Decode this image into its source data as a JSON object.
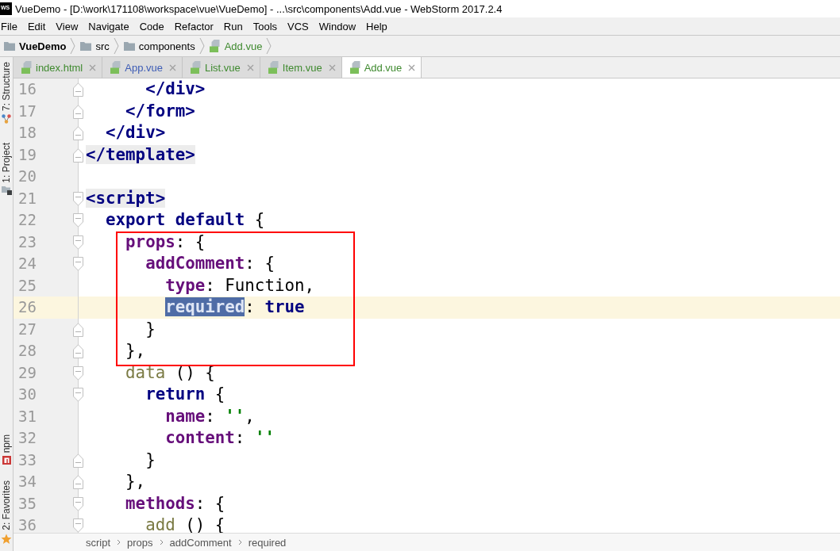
{
  "window": {
    "app_icon": "WS",
    "title": "VueDemo - [D:\\work\\171108\\workspace\\vue\\VueDemo] - ...\\src\\components\\Add.vue - WebStorm 2017.2.4"
  },
  "menu": [
    "File",
    "Edit",
    "View",
    "Navigate",
    "Code",
    "Refactor",
    "Run",
    "Tools",
    "VCS",
    "Window",
    "Help"
  ],
  "navigation_bar": [
    {
      "label": "VueDemo",
      "kind": "project"
    },
    {
      "label": "src",
      "kind": "folder"
    },
    {
      "label": "components",
      "kind": "folder"
    },
    {
      "label": "Add.vue",
      "kind": "file"
    }
  ],
  "tool_windows": {
    "top": [
      {
        "label": "7: Structure"
      },
      {
        "label": "1: Project"
      }
    ],
    "bottom": [
      {
        "label": "npm"
      },
      {
        "label": "2: Favorites"
      }
    ]
  },
  "tabs": [
    {
      "label": "index.html",
      "color": "#3f8a2f",
      "selected": false
    },
    {
      "label": "App.vue",
      "color": "#3d5cb5",
      "selected": false
    },
    {
      "label": "List.vue",
      "color": "#3f8a2f",
      "selected": false
    },
    {
      "label": "Item.vue",
      "color": "#3f8a2f",
      "selected": false
    },
    {
      "label": "Add.vue",
      "color": "#3f8a2f",
      "selected": true
    }
  ],
  "editor": {
    "lines": [
      {
        "number": "16",
        "fold_start": false,
        "fold_end": true,
        "current": false,
        "tokens": [
          {
            "text": "      </div>",
            "kind": "tag",
            "selected": false
          }
        ]
      },
      {
        "number": "17",
        "fold_start": false,
        "fold_end": true,
        "current": false,
        "tokens": [
          {
            "text": "    </form>",
            "kind": "tag",
            "selected": false
          }
        ]
      },
      {
        "number": "18",
        "fold_start": false,
        "fold_end": true,
        "current": false,
        "tokens": [
          {
            "text": "  </div>",
            "kind": "tag",
            "selected": false
          }
        ]
      },
      {
        "number": "19",
        "fold_start": false,
        "fold_end": true,
        "current": false,
        "tokens": [
          {
            "text": "</template>",
            "kind": "root_tag",
            "selected": false
          }
        ]
      },
      {
        "number": "20",
        "fold_start": false,
        "fold_end": false,
        "current": false
      },
      {
        "number": "21",
        "fold_start": true,
        "fold_end": false,
        "current": false,
        "tokens": [
          {
            "text": "<script>",
            "kind": "root_tag",
            "selected": false
          }
        ]
      },
      {
        "number": "22",
        "fold_start": true,
        "fold_end": false,
        "current": false,
        "tokens": [
          {
            "text": "  export default",
            "kind": "keyword",
            "selected": false
          },
          {
            "text": " {",
            "kind": "plain",
            "selected": false
          }
        ]
      },
      {
        "number": "23",
        "fold_start": true,
        "fold_end": false,
        "current": false,
        "tokens": [
          {
            "text": "    props",
            "kind": "property",
            "selected": false
          },
          {
            "text": ": {",
            "kind": "plain",
            "selected": false
          }
        ]
      },
      {
        "number": "24",
        "fold_start": true,
        "fold_end": false,
        "current": false,
        "tokens": [
          {
            "text": "      addComment",
            "kind": "property",
            "selected": false
          },
          {
            "text": ": {",
            "kind": "plain",
            "selected": false
          }
        ]
      },
      {
        "number": "25",
        "fold_start": false,
        "fold_end": false,
        "current": false,
        "tokens": [
          {
            "text": "        type",
            "kind": "property",
            "selected": false
          },
          {
            "text": ": Function,",
            "kind": "plain",
            "selected": false
          }
        ]
      },
      {
        "number": "26",
        "fold_start": false,
        "fold_end": false,
        "current": true,
        "tokens": [
          {
            "text": "        required",
            "kind": "property",
            "selected": true
          },
          {
            "text": ": ",
            "kind": "plain",
            "selected": false
          },
          {
            "text": "true",
            "kind": "keyword",
            "selected": false
          }
        ]
      },
      {
        "number": "27",
        "fold_start": false,
        "fold_end": true,
        "current": false,
        "tokens": [
          {
            "text": "      }",
            "kind": "plain",
            "selected": false
          }
        ]
      },
      {
        "number": "28",
        "fold_start": false,
        "fold_end": true,
        "current": false,
        "tokens": [
          {
            "text": "    },",
            "kind": "plain",
            "selected": false
          }
        ]
      },
      {
        "number": "29",
        "fold_start": true,
        "fold_end": false,
        "current": false,
        "tokens": [
          {
            "text": "    data",
            "kind": "function",
            "selected": false
          },
          {
            "text": " () {",
            "kind": "plain",
            "selected": false
          }
        ]
      },
      {
        "number": "30",
        "fold_start": true,
        "fold_end": false,
        "current": false,
        "tokens": [
          {
            "text": "      return",
            "kind": "keyword",
            "selected": false
          },
          {
            "text": " {",
            "kind": "plain",
            "selected": false
          }
        ]
      },
      {
        "number": "31",
        "fold_start": false,
        "fold_end": false,
        "current": false,
        "tokens": [
          {
            "text": "        name",
            "kind": "property",
            "selected": false
          },
          {
            "text": ": ",
            "kind": "plain",
            "selected": false
          },
          {
            "text": "''",
            "kind": "string",
            "selected": false
          },
          {
            "text": ",",
            "kind": "plain",
            "selected": false
          }
        ]
      },
      {
        "number": "32",
        "fold_start": false,
        "fold_end": false,
        "current": false,
        "tokens": [
          {
            "text": "        content",
            "kind": "property",
            "selected": false
          },
          {
            "text": ": ",
            "kind": "plain",
            "selected": false
          },
          {
            "text": "''",
            "kind": "string",
            "selected": false
          }
        ]
      },
      {
        "number": "33",
        "fold_start": false,
        "fold_end": true,
        "current": false,
        "tokens": [
          {
            "text": "      }",
            "kind": "plain",
            "selected": false
          }
        ]
      },
      {
        "number": "34",
        "fold_start": false,
        "fold_end": true,
        "current": false,
        "tokens": [
          {
            "text": "    },",
            "kind": "plain",
            "selected": false
          }
        ]
      },
      {
        "number": "35",
        "fold_start": true,
        "fold_end": false,
        "current": false,
        "tokens": [
          {
            "text": "    methods",
            "kind": "property",
            "selected": false
          },
          {
            "text": ": {",
            "kind": "plain",
            "selected": false
          }
        ]
      },
      {
        "number": "36",
        "fold_start": true,
        "fold_end": false,
        "current": false,
        "tokens": [
          {
            "text": "      add",
            "kind": "function",
            "selected": false
          },
          {
            "text": " () {",
            "kind": "plain",
            "selected": false
          }
        ]
      }
    ]
  },
  "breadcrumbs": [
    "script",
    "props",
    "addComment",
    "required"
  ]
}
